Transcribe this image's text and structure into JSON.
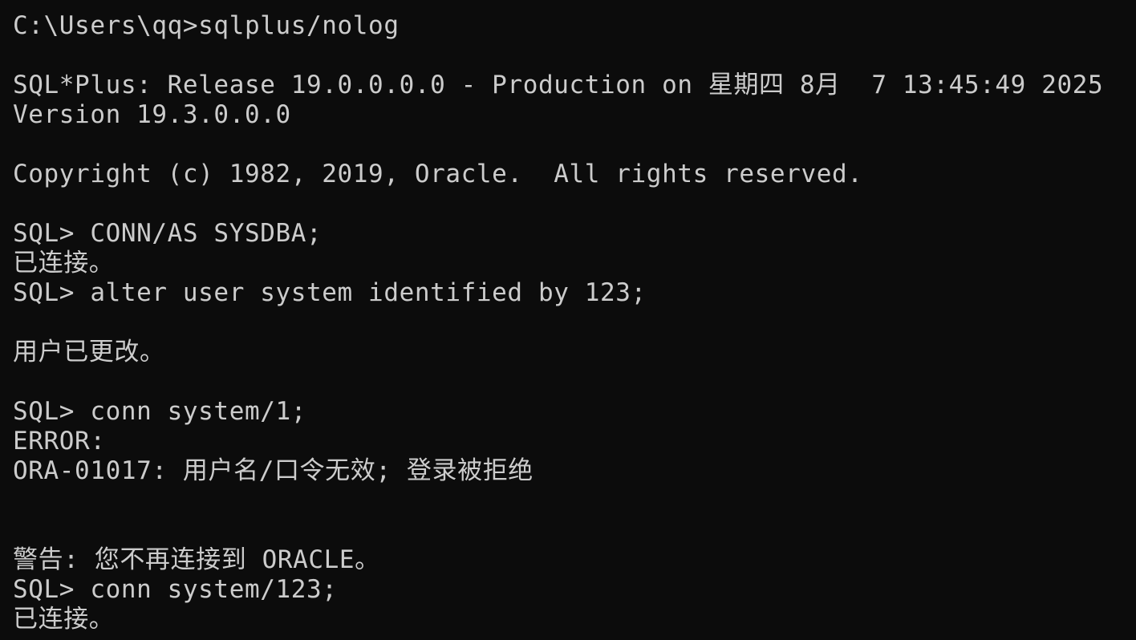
{
  "terminal": {
    "colors": {
      "background": "#0c0c0c",
      "foreground": "#cccccc"
    },
    "lines": [
      "C:\\Users\\qq>sqlplus/nolog",
      "",
      "SQL*Plus: Release 19.0.0.0.0 - Production on 星期四 8月  7 13:45:49 2025",
      "Version 19.3.0.0.0",
      "",
      "Copyright (c) 1982, 2019, Oracle.  All rights reserved.",
      "",
      "SQL> CONN/AS SYSDBA;",
      "已连接。",
      "SQL> alter user system identified by 123;",
      "",
      "用户已更改。",
      "",
      "SQL> conn system/1;",
      "ERROR:",
      "ORA-01017: 用户名/口令无效; 登录被拒绝",
      "",
      "",
      "警告: 您不再连接到 ORACLE。",
      "SQL> conn system/123;",
      "已连接。"
    ]
  }
}
